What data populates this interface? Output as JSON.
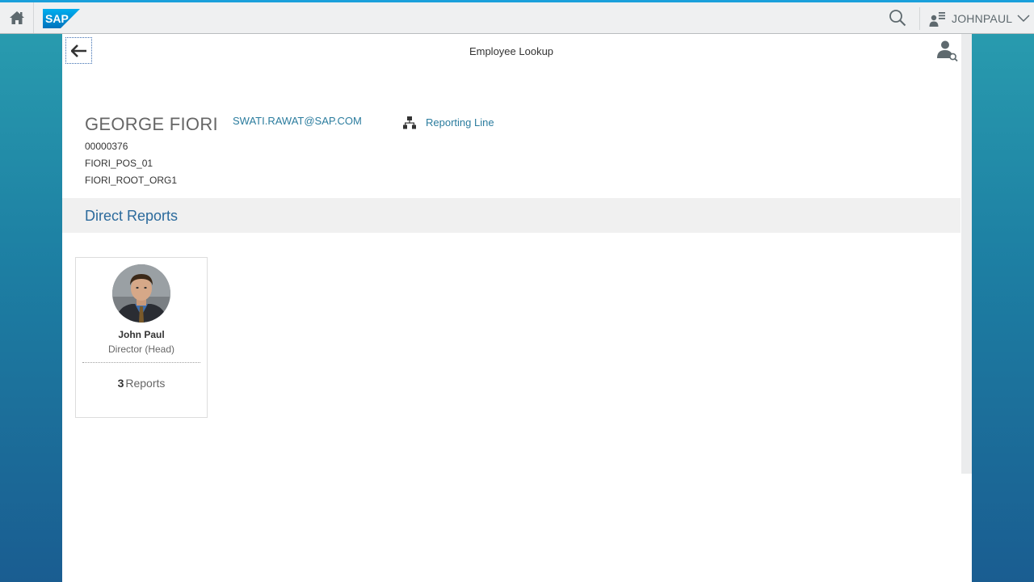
{
  "shell": {
    "logo_text": "SAP",
    "user_name": "JOHNPAUL",
    "icons": [
      "home-icon",
      "search-icon",
      "user-menu-icon",
      "chevron-down-icon"
    ]
  },
  "page": {
    "title": "Employee Lookup",
    "icons": [
      "back-arrow-icon",
      "employee-search-icon"
    ]
  },
  "employee": {
    "name": "GEORGE FIORI",
    "email": "SWATI.RAWAT@SAP.COM",
    "reporting_line_label": "Reporting Line",
    "id": "00000376",
    "position": "FIORI_POS_01",
    "org_unit": "FIORI_ROOT_ORG1"
  },
  "direct_reports": {
    "section_title": "Direct Reports",
    "items": [
      {
        "name": "John Paul",
        "role": "Director (Head)",
        "report_count": "3",
        "reports_label": "Reports"
      }
    ]
  },
  "colors": {
    "shell_accent": "#1aa0db",
    "link": "#2b7c9e",
    "section_title": "#2b6a9c",
    "background_top": "#2a9fb0",
    "background_bottom": "#1a5d91"
  }
}
